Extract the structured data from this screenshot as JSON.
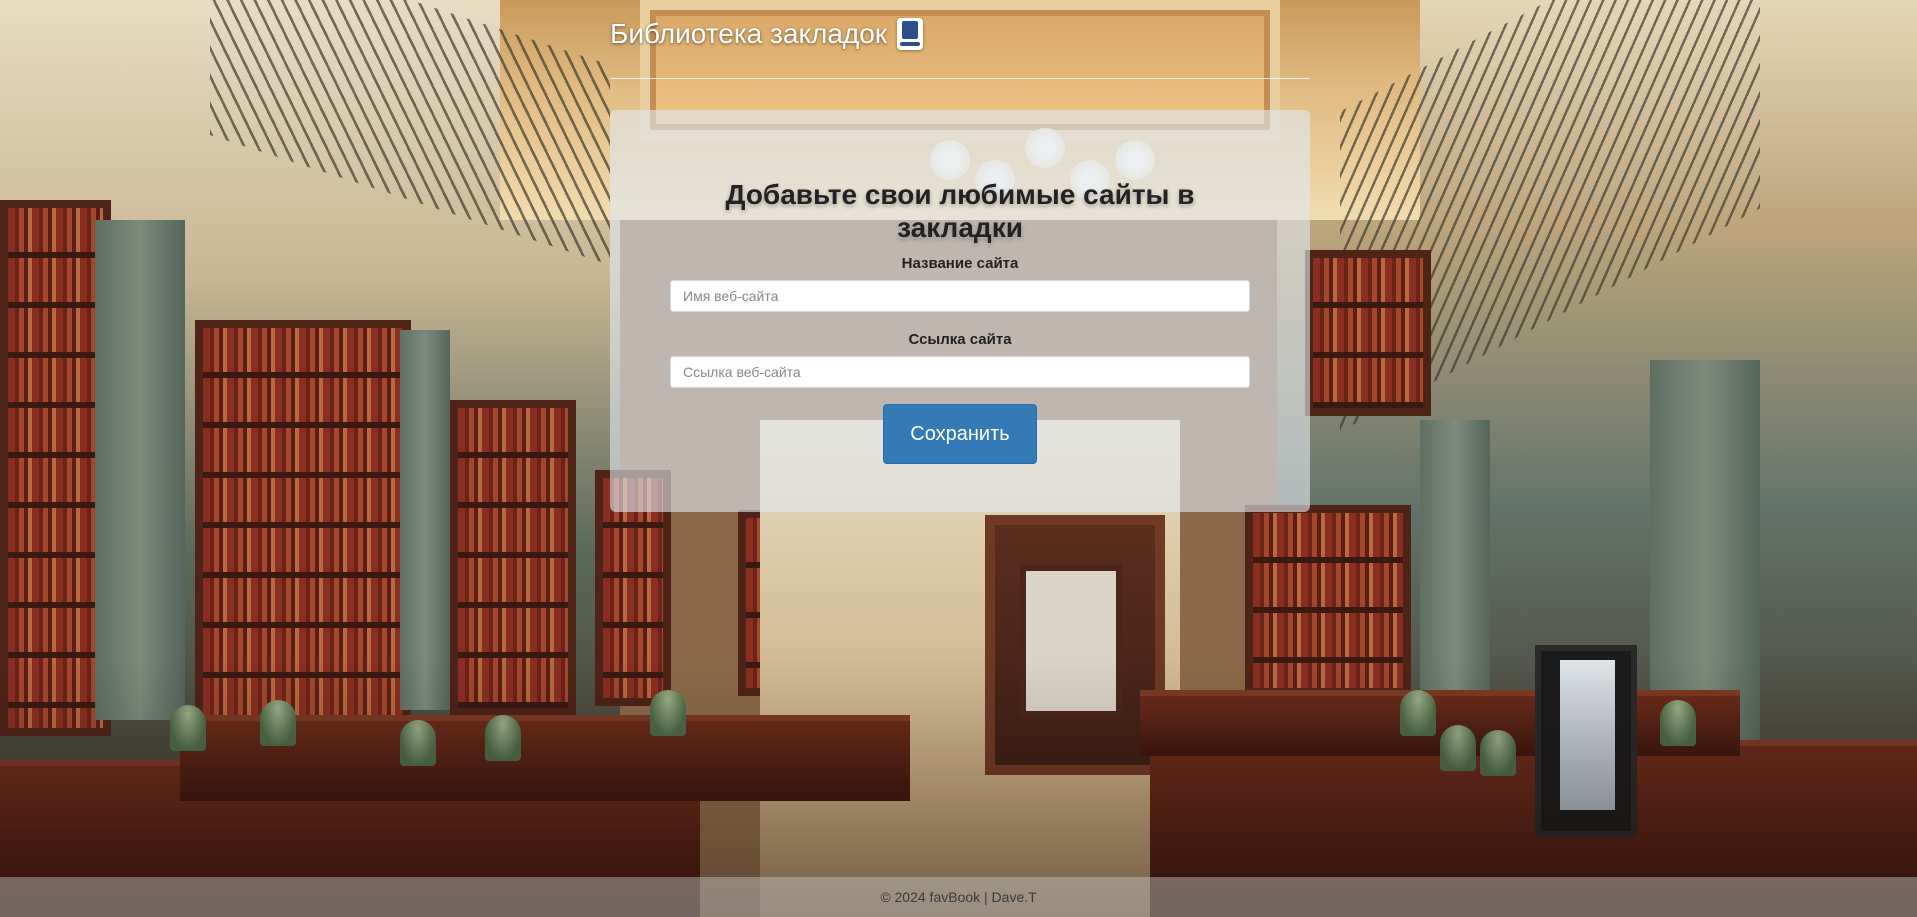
{
  "header": {
    "title": "Библиотека закладок",
    "icon": "bookmark-book-icon"
  },
  "form": {
    "heading": "Добавьте свои любимые сайты в закладки",
    "site_name_label": "Название сайта",
    "site_name_placeholder": "Имя веб-сайта",
    "site_name_value": "",
    "site_url_label": "Ссылка сайта",
    "site_url_placeholder": "Ссылка веб-сайта",
    "site_url_value": "",
    "save_label": "Сохранить"
  },
  "footer": {
    "text": "© 2024 favBook | Dave.T"
  },
  "colors": {
    "primary_button": "#337ab7",
    "card_background": "rgba(225,230,238,0.62)",
    "header_text": "#ffffff"
  }
}
